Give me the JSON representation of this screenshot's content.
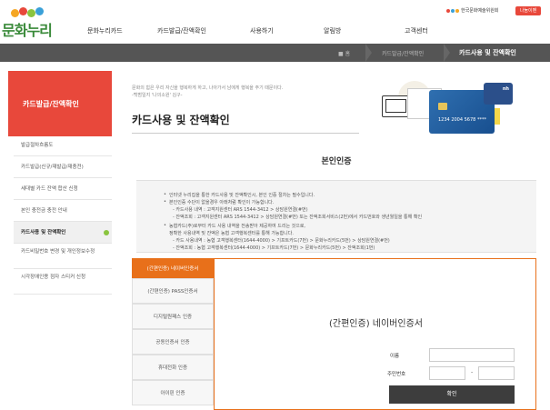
{
  "header": {
    "logo_text": "문화누리",
    "gnb": [
      "문화누리카드",
      "카드발급/잔액확인",
      "사용하기",
      "알림방",
      "고객센터"
    ],
    "org_name": "한국문화예술위원회",
    "badge": "나눔이벤"
  },
  "breadcrumb": {
    "home": "홈",
    "parent": "카드발급/잔액확인",
    "current": "카드사용 및 잔액확인"
  },
  "sidebar": {
    "title": "카드발급/잔액확인",
    "items": [
      {
        "label": "발급절차흐름도"
      },
      {
        "label": "카드발급(신규/재발급/재충전)"
      },
      {
        "label": "세대별 카드 잔액 합산 신청"
      },
      {
        "label": "본인 충전금 충전 안내"
      },
      {
        "label": "카드사용 및 잔액확인"
      },
      {
        "label": "카드비밀번호 변경 및 개인정보수정"
      },
      {
        "label": "시각장애인용 점자 스티커 신청"
      }
    ]
  },
  "intro": {
    "line1": "문화의 힘은 우리 자신을 행복하게 하고, 나아가서 남에게 행복을 주기 때문이다.",
    "line2": "-백범일지 '나의소원' 김구-"
  },
  "page_title": "카드사용 및 잔액확인",
  "illust": {
    "card_number": "1234 2004 5678 ****",
    "card_logo": "nh"
  },
  "section_title": "본인인증",
  "notice": {
    "lines": [
      "인터넷 누리집을 통한 카드사용 및 잔액확인시, 본인 인증 절차는 필수입니다.",
      "본인인증 수단이 없을경우 아래처럼 확인이 가능합니다.",
      "- 카드사용 내역 : 고객지원센터 ARS 1544-3412 > 상담원연결(#번)",
      "- 잔액조회 : 고객지원센터 ARS 1544-3412 > 상담원연결(#번) 또는 잔액조회서비스(2번)에서 카드번호와 생년월일을 통해 확인",
      "농협카드(주)로부터 카드 사용 내역을 전송받아 제공하여 드리는 것으로,",
      "정확한 사용내역 및 잔액은 농협 고객행복센터를 통해 가능합니다.",
      "- 카드 사용내역 : 농협 고객행복센터(1644-4000) > 기프트카드(7번) > 문화누리카드(5번) > 상담원연결(#번)",
      "- 잔액조회 : 농협 고객행복센터(1644-4000) > 기프트카드(7번) > 문화누리카드(5번) > 잔액조회(1번)"
    ]
  },
  "auth": {
    "tabs": [
      {
        "label": "(간편인증) 네이버인증서"
      },
      {
        "label": "(간편인증) PASS인증서"
      },
      {
        "label": "디지털원패스 인증"
      },
      {
        "label": "공동인증서 인증"
      },
      {
        "label": "휴대전화 인증"
      },
      {
        "label": "아이핀 인증"
      }
    ],
    "heading": "(간편인증) 네이버인증서",
    "name_label": "이름",
    "rrn_label": "주민번호",
    "dash": "-",
    "confirm": "확인"
  },
  "colors": {
    "accent_red": "#e8483b",
    "accent_orange": "#e8701a",
    "dark_bar": "#555555",
    "active_dot": "#8ac43f"
  }
}
